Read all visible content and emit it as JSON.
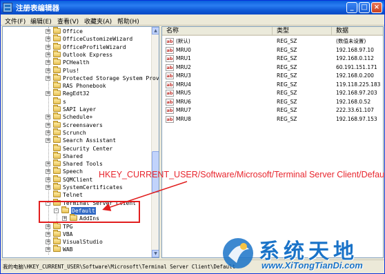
{
  "window": {
    "title": "注册表编辑器",
    "minimize_glyph": "_",
    "maximize_glyph": "□",
    "close_glyph": "×"
  },
  "menu": [
    "文件(F)",
    "编辑(E)",
    "查看(V)",
    "收藏夹(A)",
    "帮助(H)"
  ],
  "tree": {
    "items": [
      {
        "label": "Office",
        "expander": "+"
      },
      {
        "label": "OfficeCustomizeWizard",
        "expander": "+"
      },
      {
        "label": "OfficeProfileWizard",
        "expander": "+"
      },
      {
        "label": "Outlook Express",
        "expander": "+"
      },
      {
        "label": "PCHealth",
        "expander": "+"
      },
      {
        "label": "Plus!",
        "expander": "+"
      },
      {
        "label": "Protected Storage System Provi",
        "expander": "+"
      },
      {
        "label": "RAS Phonebook",
        "expander": ""
      },
      {
        "label": "RegEdt32",
        "expander": "+"
      },
      {
        "label": "s",
        "expander": ""
      },
      {
        "label": "SAPI Layer",
        "expander": ""
      },
      {
        "label": "Schedule+",
        "expander": "+"
      },
      {
        "label": "Screensavers",
        "expander": "+"
      },
      {
        "label": "Scrunch",
        "expander": "+"
      },
      {
        "label": "Search Assistant",
        "expander": "+"
      },
      {
        "label": "Security Center",
        "expander": ""
      },
      {
        "label": "Shared",
        "expander": ""
      },
      {
        "label": "Shared Tools",
        "expander": "+"
      },
      {
        "label": "Speech",
        "expander": "+"
      },
      {
        "label": "SQMClient",
        "expander": "+"
      },
      {
        "label": "SystemCertificates",
        "expander": "+"
      },
      {
        "label": "Telnet",
        "expander": ""
      },
      {
        "label": "Terminal Server Client",
        "expander": "-"
      },
      {
        "label": "Default",
        "expander": "-",
        "selected": true
      },
      {
        "label": "AddIns",
        "expander": "+"
      },
      {
        "label": "TPG",
        "expander": "+"
      },
      {
        "label": "VBA",
        "expander": "+"
      },
      {
        "label": "VisualStudio",
        "expander": "+"
      },
      {
        "label": "WAB",
        "expander": "+"
      }
    ]
  },
  "list": {
    "headers": {
      "name": "名称",
      "type": "类型",
      "data": "数据"
    },
    "rows": [
      {
        "name": "(默认)",
        "type": "REG_SZ",
        "data": "(数值未设置)"
      },
      {
        "name": "MRU0",
        "type": "REG_SZ",
        "data": "192.168.97.10"
      },
      {
        "name": "MRU1",
        "type": "REG_SZ",
        "data": "192.168.0.112"
      },
      {
        "name": "MRU2",
        "type": "REG_SZ",
        "data": "60.191.151.171"
      },
      {
        "name": "MRU3",
        "type": "REG_SZ",
        "data": "192.168.0.200"
      },
      {
        "name": "MRU4",
        "type": "REG_SZ",
        "data": "119.118.225.183"
      },
      {
        "name": "MRU5",
        "type": "REG_SZ",
        "data": "192.168.97.203"
      },
      {
        "name": "MRU6",
        "type": "REG_SZ",
        "data": "192.168.0.52"
      },
      {
        "name": "MRU7",
        "type": "REG_SZ",
        "data": "222.33.61.107"
      },
      {
        "name": "MRU8",
        "type": "REG_SZ",
        "data": "192.168.97.153"
      }
    ],
    "value_icon_text": "ab"
  },
  "annotation": {
    "text": "HKEY_CURRENT_USER/Software/Microsoft/Terminal Server Client/Default",
    "color": "#e8262e"
  },
  "status": {
    "path": "我的电脑\\HKEY_CURRENT_USER\\Software\\Microsoft\\Terminal Server Client\\Default"
  },
  "watermark": {
    "title": "系统天地",
    "url": "www.XiTongTianDi.com"
  },
  "colors": {
    "titlebar": "#0a5fdc",
    "selection": "#316ac5",
    "annotation_red": "#e11d1d",
    "watermark_blue": "#1a73c8"
  }
}
